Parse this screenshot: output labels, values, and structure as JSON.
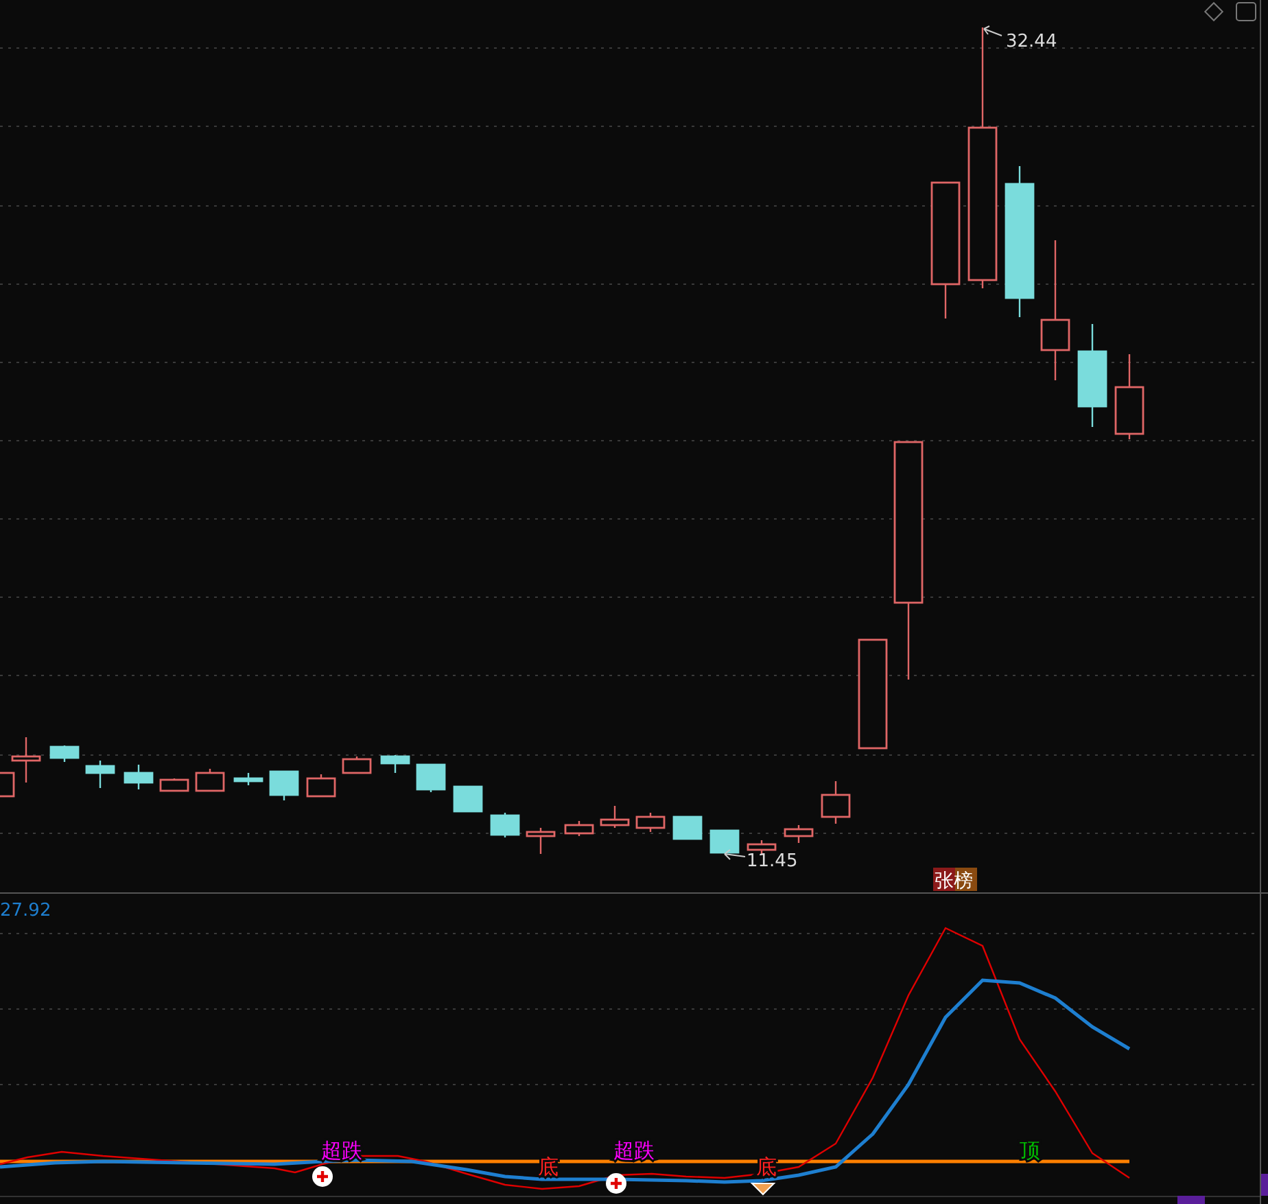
{
  "price_panel": {
    "high_label": "32.44",
    "low_label": "11.45",
    "badge": "张榜"
  },
  "indicator_panel": {
    "value": "27.92",
    "signals": [
      {
        "kind": "oversold",
        "text": "超跌",
        "color": "#ff00ff"
      },
      {
        "kind": "bottom",
        "text": "底",
        "color": "#ff2020"
      },
      {
        "kind": "oversold",
        "text": "超跌",
        "color": "#ff00ff"
      },
      {
        "kind": "bottom",
        "text": "底",
        "color": "#ff2020"
      },
      {
        "kind": "top",
        "text": "顶",
        "color": "#00c000"
      }
    ]
  }
}
